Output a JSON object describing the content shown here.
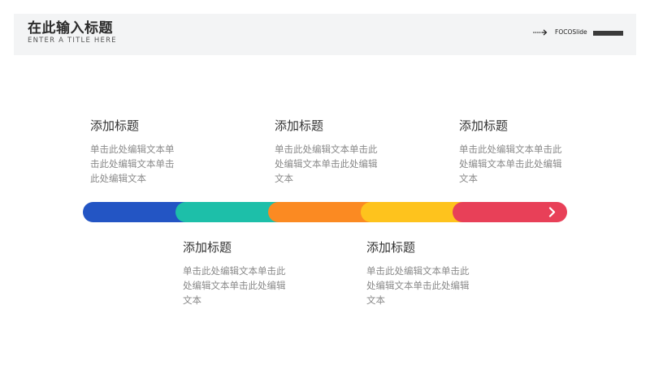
{
  "header": {
    "title": "在此输入标题",
    "subtitle": "ENTER A TITLE HERE",
    "brand": "FOCOSlide",
    "arrow_icon": "dotted-arrow-icon"
  },
  "timeline": {
    "segments": [
      {
        "color": "#2355c4",
        "icon": "chevron-right-icon"
      },
      {
        "color": "#1dbfa9",
        "icon": "chevron-right-icon"
      },
      {
        "color": "#fb8a22",
        "icon": "chevron-right-icon"
      },
      {
        "color": "#fec31d",
        "icon": "chevron-right-icon"
      },
      {
        "color": "#e84058",
        "icon": "chevron-right-icon"
      }
    ]
  },
  "items": [
    {
      "title": "添加标题",
      "body": "单击此处编辑文本单击此处编辑文本单击此处编辑文本"
    },
    {
      "title": "添加标题",
      "body": "单击此处编辑文本单击此处编辑文本单击此处编辑文本"
    },
    {
      "title": "添加标题",
      "body": "单击此处编辑文本单击此处编辑文本单击此处编辑文本"
    },
    {
      "title": "添加标题",
      "body": "单击此处编辑文本单击此处编辑文本单击此处编辑文本"
    },
    {
      "title": "添加标题",
      "body": "单击此处编辑文本单击此处编辑文本单击此处编辑文本"
    }
  ]
}
